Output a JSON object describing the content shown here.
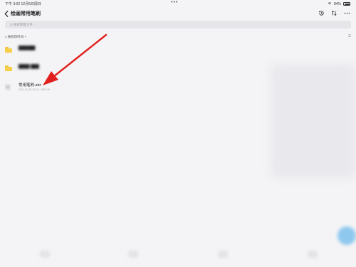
{
  "status_bar": {
    "time_date": "下午 3:02   12月5日周日",
    "dots": "•••",
    "battery_percent": "84%"
  },
  "nav": {
    "title": "绘画常用笔刷"
  },
  "search": {
    "placeholder": "Q 搜索网盘文件"
  },
  "sort": {
    "label": "1 按修改时间 ˅",
    "view_toggle": "☷"
  },
  "files": [
    {
      "type": "folder",
      "name": "██████",
      "meta": "",
      "blurred": true
    },
    {
      "type": "folder",
      "name": "████ ███",
      "meta": "",
      "blurred": true
    },
    {
      "type": "file",
      "name": "常用笔刷.abr",
      "meta": "2021-11-28 10:14 · 105 KM",
      "blurred": false
    }
  ],
  "colors": {
    "annotation_arrow": "#e0201e",
    "folder": "#f6cf4a",
    "fab": "#8fc8ee"
  },
  "icons": {
    "back": "chevron-left-icon",
    "history": "clock-icon",
    "sort": "sort-arrows-icon",
    "more": "ellipsis-icon"
  }
}
